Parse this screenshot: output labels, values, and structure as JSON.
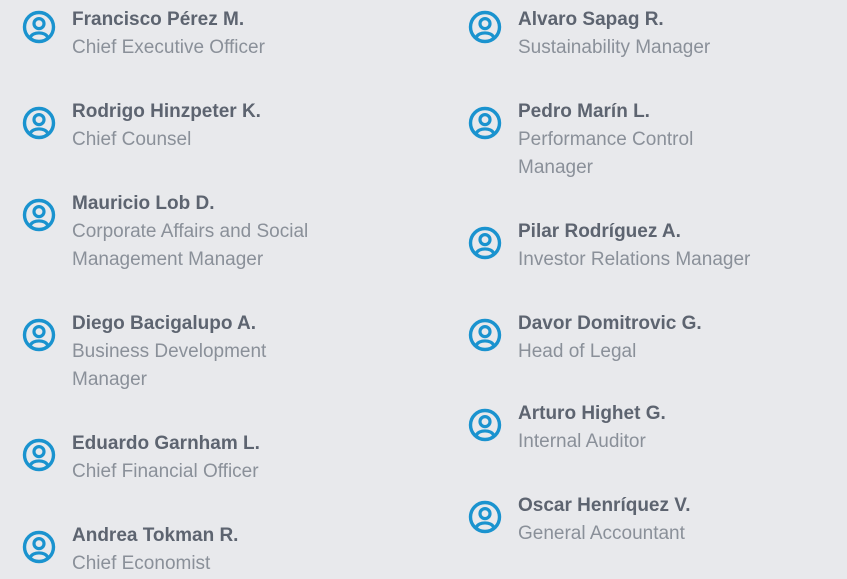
{
  "accent_color": "#1a93cf",
  "icon_name": "user-circle-icon",
  "left_column": [
    {
      "name": "Francisco Pérez M.",
      "role_lines": [
        "Chief Executive Officer"
      ]
    },
    {
      "name": "Rodrigo Hinzpeter K.",
      "role_lines": [
        "Chief Counsel"
      ]
    },
    {
      "name": "Mauricio Lob D.",
      "role_lines": [
        "Corporate Affairs and Social",
        "Management Manager"
      ]
    },
    {
      "name": "Diego Bacigalupo A.",
      "role_lines": [
        "Business Development",
        "Manager"
      ]
    },
    {
      "name": "Eduardo Garnham L.",
      "role_lines": [
        "Chief Financial Officer"
      ]
    },
    {
      "name": "Andrea Tokman R.",
      "role_lines": [
        "Chief Economist"
      ]
    }
  ],
  "right_column": [
    {
      "name": "Alvaro Sapag R.",
      "role_lines": [
        "Sustainability Manager"
      ]
    },
    {
      "name": "Pedro Marín L.",
      "role_lines": [
        "Performance Control",
        "Manager"
      ]
    },
    {
      "name": "Pilar Rodríguez A.",
      "role_lines": [
        "Investor Relations Manager"
      ]
    },
    {
      "name": "Davor Domitrovic G.",
      "role_lines": [
        "Head of Legal"
      ]
    },
    {
      "name": "Arturo Highet G.",
      "role_lines": [
        "Internal Auditor"
      ]
    },
    {
      "name": "Oscar Henríquez V.",
      "role_lines": [
        "General Accountant"
      ]
    }
  ]
}
